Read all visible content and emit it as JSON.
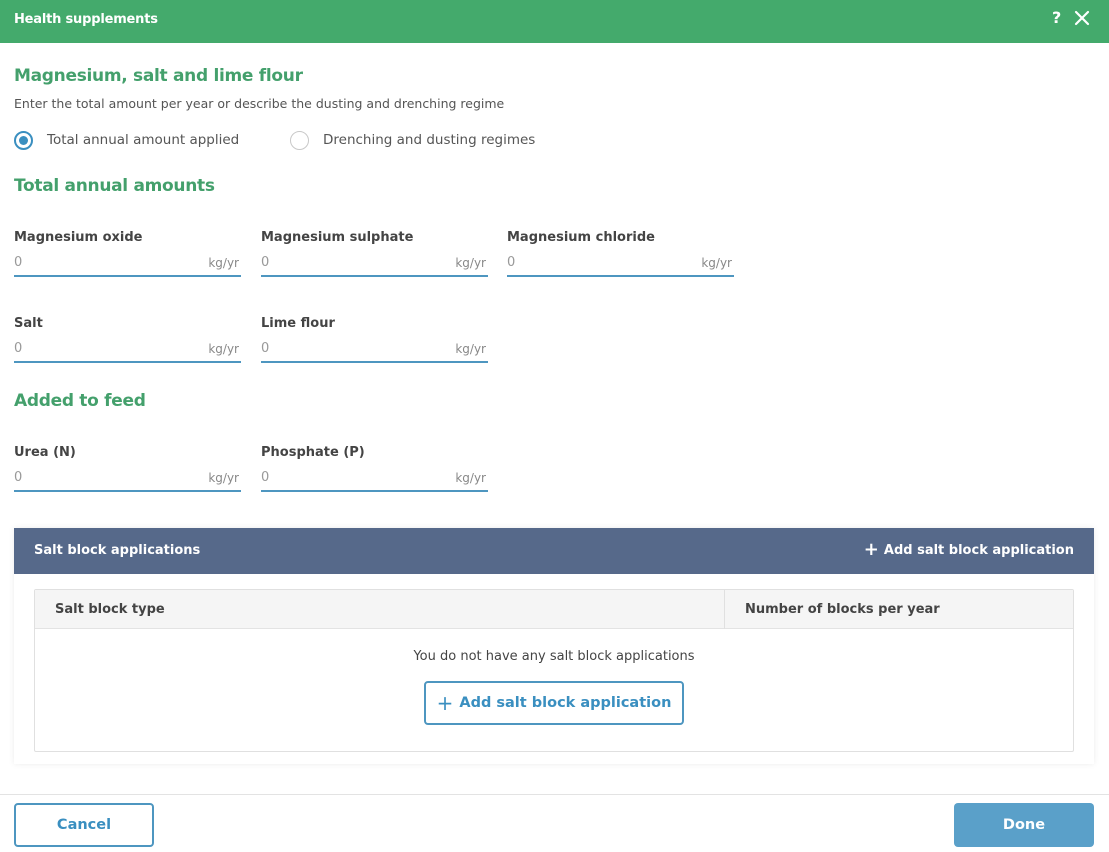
{
  "dialog": {
    "title": "Health supplements",
    "help_icon": "question-mark-icon",
    "help_glyph": "?",
    "close_icon": "close-icon"
  },
  "section_mag": {
    "heading": "Magnesium, salt and lime flour",
    "subtext": "Enter the total amount per year or describe the dusting and drenching regime",
    "options": [
      {
        "label": "Total annual amount applied",
        "checked": true
      },
      {
        "label": "Drenching and dusting regimes",
        "checked": false
      }
    ]
  },
  "section_totals": {
    "heading": "Total annual amounts",
    "fields": [
      {
        "label": "Magnesium oxide",
        "value": "0",
        "unit": "kg/yr"
      },
      {
        "label": "Magnesium sulphate",
        "value": "0",
        "unit": "kg/yr"
      },
      {
        "label": "Magnesium chloride",
        "value": "0",
        "unit": "kg/yr"
      },
      {
        "label": "Salt",
        "value": "0",
        "unit": "kg/yr"
      },
      {
        "label": "Lime flour",
        "value": "0",
        "unit": "kg/yr"
      }
    ]
  },
  "section_feed": {
    "heading": "Added to feed",
    "fields": [
      {
        "label": "Urea (N)",
        "value": "0",
        "unit": "kg/yr"
      },
      {
        "label": "Phosphate (P)",
        "value": "0",
        "unit": "kg/yr"
      }
    ]
  },
  "salt_blocks": {
    "title": "Salt block applications",
    "add_label": "Add salt block application",
    "add_icon": "plus-icon",
    "columns": [
      "Salt block type",
      "Number of blocks per year"
    ],
    "empty_message": "You do not have any salt block applications",
    "empty_button_label": "Add salt block application"
  },
  "footer": {
    "cancel_label": "Cancel",
    "done_label": "Done"
  },
  "colors": {
    "header_green": "#44aa6c",
    "heading_green": "#44a06c",
    "accent_blue": "#3a8fc0",
    "panel_header": "#56698a",
    "done_button": "#5aa0c9"
  }
}
